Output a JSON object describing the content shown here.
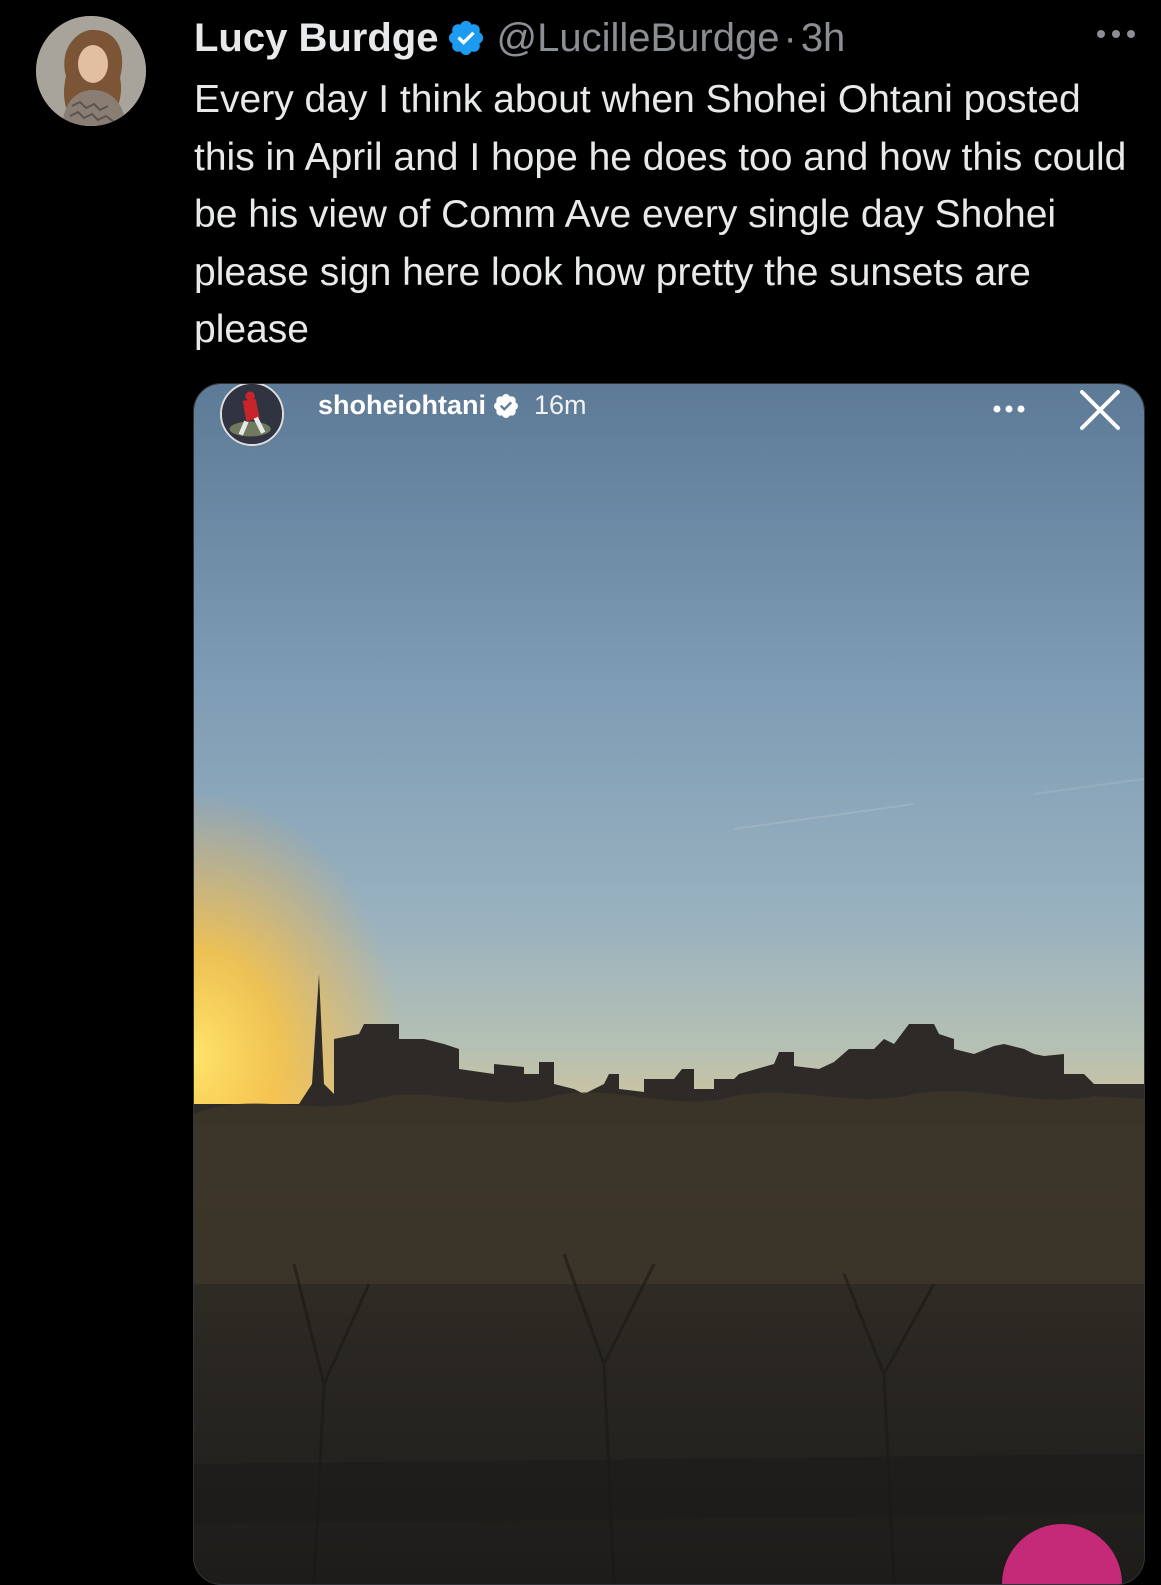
{
  "tweet": {
    "author": {
      "display_name": "Lucy Burdge",
      "handle": "@LucilleBurdge",
      "verified": true,
      "avatar_icon": "profile-photo"
    },
    "separator": "·",
    "time_ago": "3h",
    "more_icon": "more-horizontal-icon",
    "text": "Every day I think about when Shohei Ohtani posted this in April and I hope he does too and how this could be his view of Comm Ave every single day Shohei please sign here look how pretty the sunsets are please"
  },
  "embedded_story": {
    "username": "shoheiohtani",
    "verified": true,
    "time_ago": "16m",
    "more_icon": "more-horizontal-icon",
    "close_icon": "close-icon",
    "photo_subject": "city skyline at sunset"
  },
  "colors": {
    "background": "#000000",
    "text_primary": "#e7e9ea",
    "text_secondary": "#8b8f94",
    "verified_blue": "#1d9bf0"
  }
}
